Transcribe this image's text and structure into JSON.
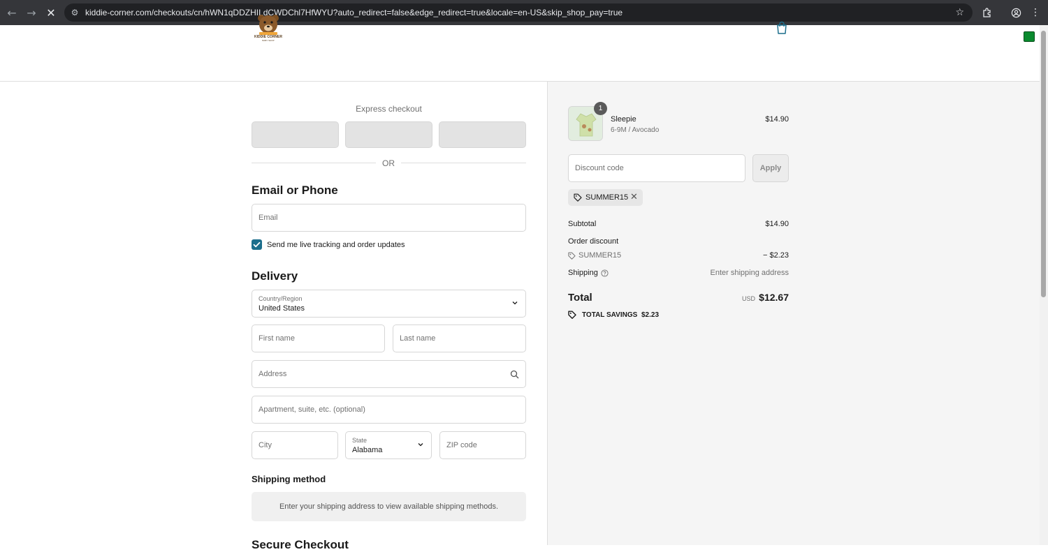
{
  "browser": {
    "url": "kiddie-corner.com/checkouts/cn/hWN1qDDZHILdCWDChl7HfWYU?auto_redirect=false&edge_redirect=true&locale=en-US&skip_shop_pay=true"
  },
  "brand": {
    "logo_text": "KIDDIE CORNER",
    "logo_subtext": "BABY SHOP"
  },
  "express": {
    "label": "Express checkout",
    "or_label": "OR"
  },
  "contact": {
    "heading": "Email or Phone",
    "email_placeholder": "Email",
    "updates_label": "Send me live tracking and order updates",
    "updates_checked": true
  },
  "delivery": {
    "heading": "Delivery",
    "country_label": "Country/Region",
    "country_value": "United States",
    "first_name_placeholder": "First name",
    "last_name_placeholder": "Last name",
    "address_placeholder": "Address",
    "apartment_placeholder": "Apartment, suite, etc. (optional)",
    "city_placeholder": "City",
    "state_label": "State",
    "state_value": "Alabama",
    "zip_placeholder": "ZIP code"
  },
  "shipping_method": {
    "heading": "Shipping method",
    "message": "Enter your shipping address to view available shipping methods."
  },
  "secure_heading": "Secure Checkout",
  "summary": {
    "item": {
      "name": "Sleepie",
      "variant": "6-9M / Avocado",
      "price": "$14.90",
      "quantity": "1"
    },
    "discount_placeholder": "Discount code",
    "apply_label": "Apply",
    "applied_code": "SUMMER15",
    "subtotal_label": "Subtotal",
    "subtotal_value": "$14.90",
    "order_discount_label": "Order discount",
    "discount_code_line": "SUMMER15",
    "discount_value": "− $2.23",
    "shipping_label": "Shipping",
    "shipping_value": "Enter shipping address",
    "total_label": "Total",
    "currency": "USD",
    "total_value": "$12.67",
    "savings_label": "TOTAL SAVINGS",
    "savings_value": "$2.23"
  },
  "colors": {
    "accent": "#1c6e8c",
    "summary_bg": "#f5f5f5",
    "extension_green": "#0a8a2e"
  }
}
